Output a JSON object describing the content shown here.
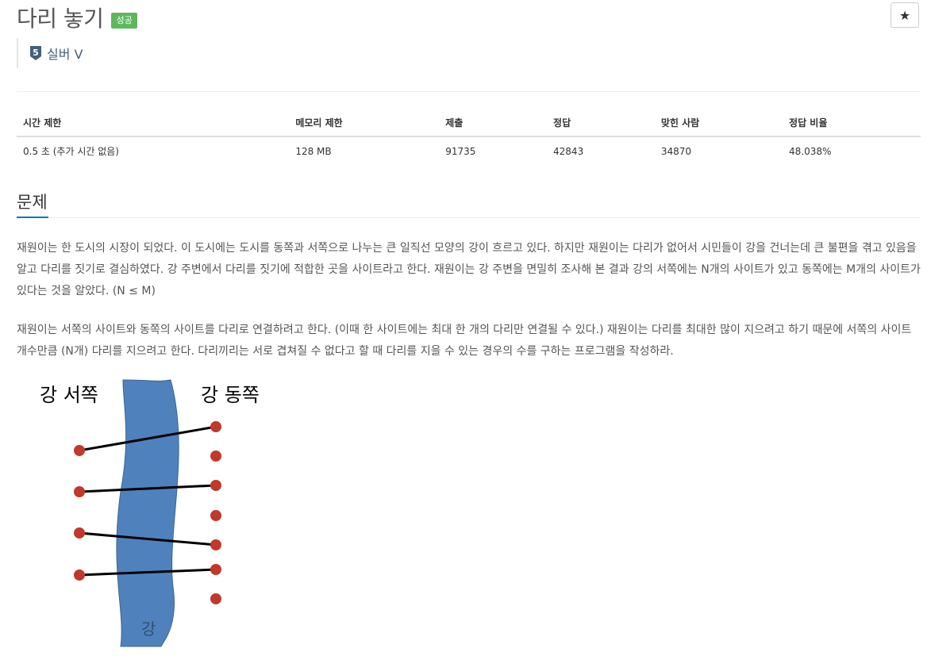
{
  "problem": {
    "title": "다리 놓기",
    "badge": "성공",
    "star": "★",
    "tier_number": "5",
    "tier_label": "실버 V"
  },
  "info_table": {
    "headers": [
      "시간 제한",
      "메모리 제한",
      "제출",
      "정답",
      "맞힌 사람",
      "정답 비율"
    ],
    "values": [
      "0.5 초 (추가 시간 없음)",
      "128 MB",
      "91735",
      "42843",
      "34870",
      "48.038%"
    ]
  },
  "section": {
    "heading": "문제",
    "paragraph1": "재원이는 한 도시의 시장이 되었다. 이 도시에는 도시를 동쪽과 서쪽으로 나누는 큰 일직선 모양의 강이 흐르고 있다. 하지만 재원이는 다리가 없어서 시민들이 강을 건너는데 큰 불편을 겪고 있음을 알고 다리를 짓기로 결심하였다. 강 주변에서 다리를 짓기에 적합한 곳을 사이트라고 한다. 재원이는 강 주변을 면밀히 조사해 본 결과 강의 서쪽에는 N개의 사이트가 있고 동쪽에는 M개의 사이트가 있다는 것을 알았다. (N ≤ M)",
    "paragraph2": "재원이는 서쪽의 사이트와 동쪽의 사이트를 다리로 연결하려고 한다. (이때 한 사이트에는 최대 한 개의 다리만 연결될 수 있다.) 재원이는 다리를 최대한 많이 지으려고 하기 때문에 서쪽의 사이트 개수만큼 (N개) 다리를 지으려고 한다. 다리끼리는 서로 겹쳐질 수 없다고 할 때 다리를 지을 수 있는 경우의 수를 구하는 프로그램을 작성하라."
  },
  "figure": {
    "west_label": "강 서쪽",
    "east_label": "강 동쪽",
    "river_label": "강",
    "colors": {
      "river": "#4f81bd",
      "river_stroke": "#3b6591",
      "site": "#c0392b",
      "bridge": "#000000"
    },
    "bridges": [
      [
        0,
        0
      ],
      [
        1,
        2
      ],
      [
        2,
        4
      ],
      [
        3,
        5
      ]
    ]
  }
}
